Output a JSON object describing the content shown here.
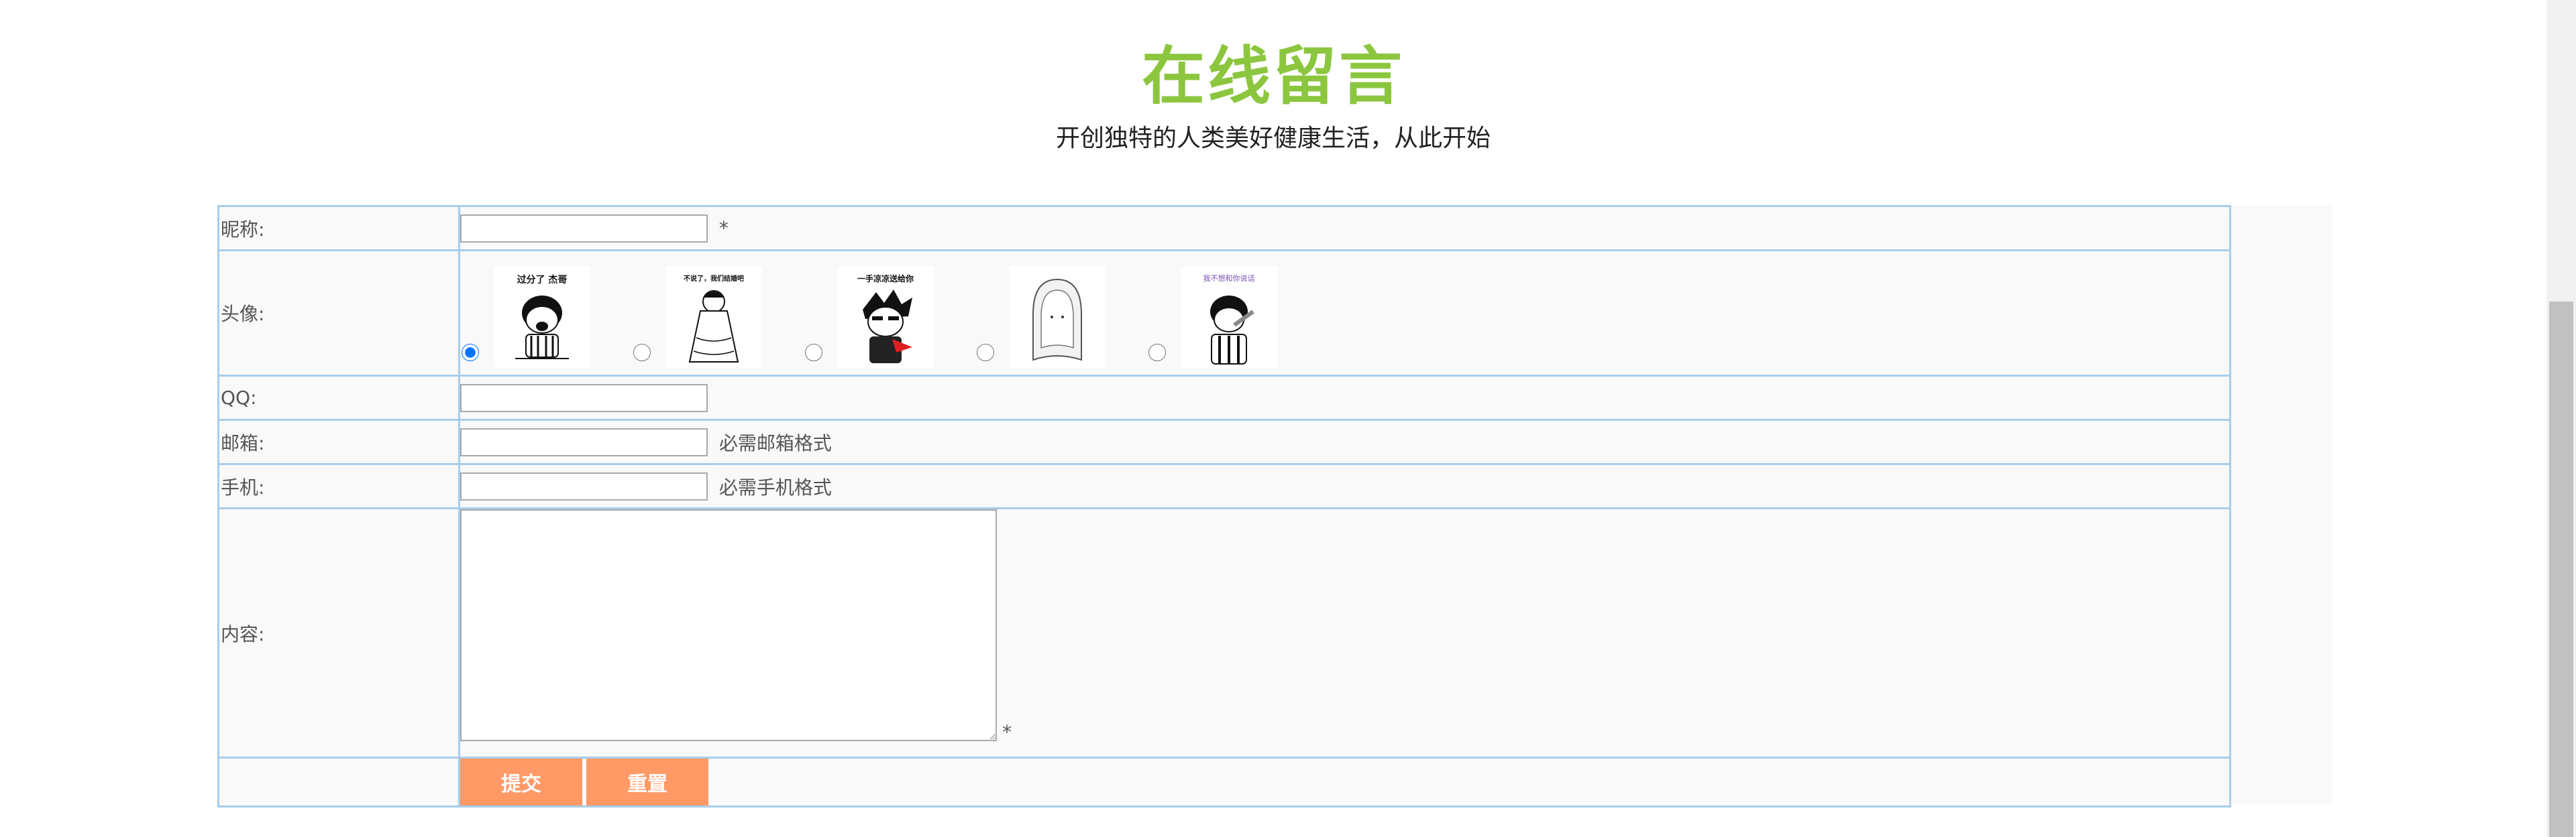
{
  "header": {
    "title": "在线留言",
    "subtitle": "开创独特的人类美好健康生活，从此开始"
  },
  "form": {
    "nickname": {
      "label": "昵称:",
      "value": "",
      "required_mark": "*"
    },
    "avatar": {
      "label": "头像:",
      "selected_index": 0,
      "options": [
        {
          "caption": "过分了 杰哥"
        },
        {
          "caption": "不说了，我们结婚吧"
        },
        {
          "caption": "一手凉凉送给你"
        },
        {
          "caption": ""
        },
        {
          "caption": "我不想和你说话"
        }
      ]
    },
    "qq": {
      "label": "QQ:",
      "value": ""
    },
    "email": {
      "label": "邮箱:",
      "value": "",
      "hint": "必需邮箱格式"
    },
    "phone": {
      "label": "手机:",
      "value": "",
      "hint": "必需手机格式"
    },
    "content": {
      "label": "内容:",
      "value": "",
      "required_mark": "*"
    },
    "buttons": {
      "submit": "提交",
      "reset": "重置"
    }
  },
  "colors": {
    "title": "#8cc63f",
    "border": "#a8cdea",
    "button": "#ff9966",
    "form_bg": "#f9f9f9"
  }
}
